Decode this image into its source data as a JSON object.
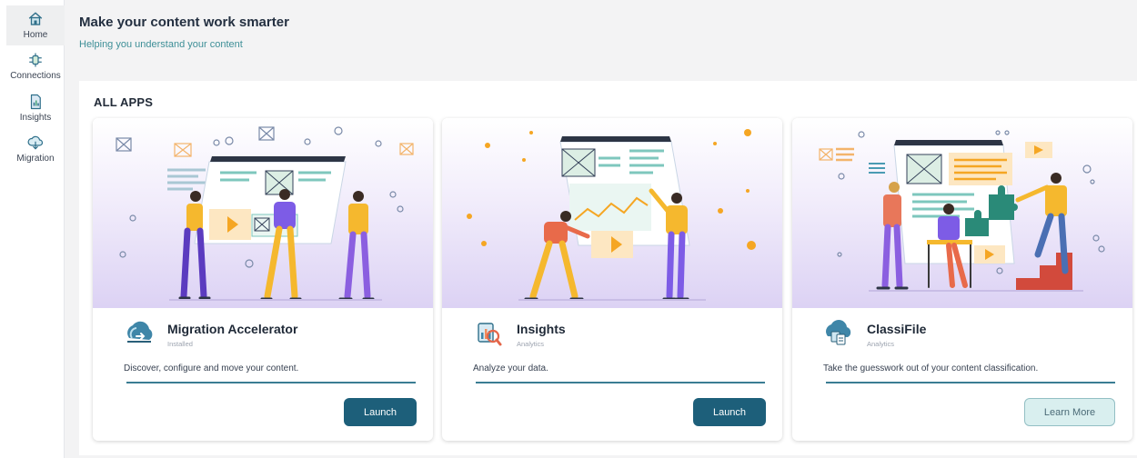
{
  "sidebar": {
    "items": [
      {
        "label": "Home",
        "icon": "home-icon",
        "active": true
      },
      {
        "label": "Connections",
        "icon": "connections-icon",
        "active": false
      },
      {
        "label": "Insights",
        "icon": "insights-icon",
        "active": false
      },
      {
        "label": "Migration",
        "icon": "migration-icon",
        "active": false
      }
    ]
  },
  "header": {
    "title": "Make your content work smarter",
    "subtitle": "Helping you understand your content"
  },
  "main": {
    "section_title": "ALL APPS",
    "apps": [
      {
        "name": "Migration Accelerator",
        "status": "Installed",
        "description": "Discover, configure and move your content.",
        "button": "Launch",
        "icon": "migration-accelerator-icon"
      },
      {
        "name": "Insights",
        "status": "Analytics",
        "description": "Analyze your data.",
        "button": "Launch",
        "icon": "insights-app-icon"
      },
      {
        "name": "ClassiFile",
        "status": "Analytics",
        "description": "Take the guesswork out of your content classification.",
        "button": "Learn More",
        "icon": "classifile-icon"
      }
    ]
  },
  "colors": {
    "accent": "#1d5f7a",
    "subtitle": "#3e8f97",
    "divider": "#3a7d93",
    "learn_more_bg": "#d9efef",
    "illustration_purple": "#dcd2f4"
  }
}
